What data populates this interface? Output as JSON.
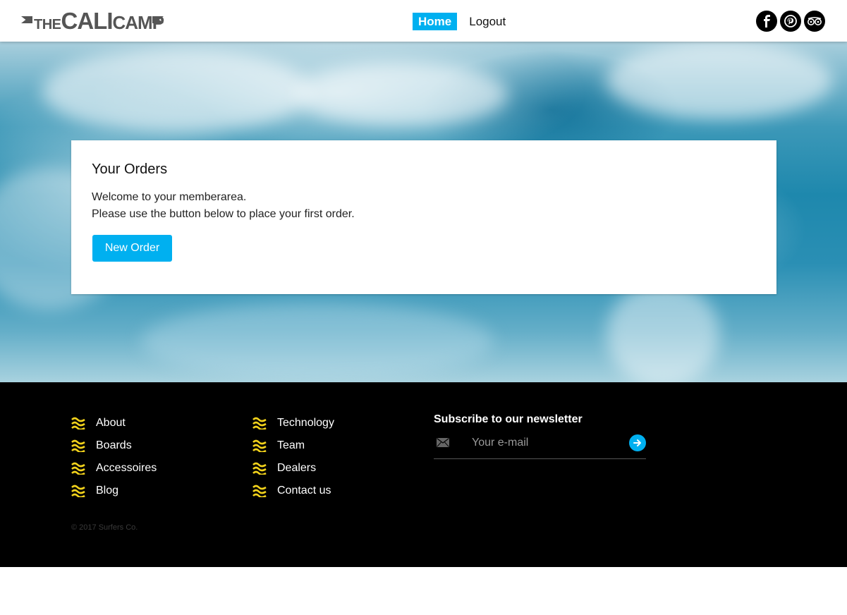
{
  "header": {
    "logo": {
      "the": "THE",
      "cali": "CALI",
      "camp": "CAMP"
    },
    "nav": [
      {
        "label": "Home",
        "active": true
      },
      {
        "label": "Logout",
        "active": false
      }
    ],
    "social_icons": [
      "facebook-icon",
      "pinterest-icon",
      "tripadvisor-icon"
    ]
  },
  "main": {
    "card": {
      "title": "Your Orders",
      "line1": "Welcome to your memberarea.",
      "line2": "Please use the button below to place your first order.",
      "button_label": "New Order"
    }
  },
  "footer": {
    "col1": [
      {
        "label": "About"
      },
      {
        "label": "Boards"
      },
      {
        "label": "Accessoires"
      },
      {
        "label": "Blog"
      }
    ],
    "col2": [
      {
        "label": "Technology"
      },
      {
        "label": "Team"
      },
      {
        "label": "Dealers"
      },
      {
        "label": "Contact us"
      }
    ],
    "newsletter": {
      "title": "Subscribe to our newsletter",
      "placeholder": "Your e-mail",
      "value": ""
    },
    "copyright": "© 2017 Surfers Co."
  },
  "colors": {
    "accent": "#00b0f0",
    "wave_icon": "#f2d21b",
    "footer_bg": "#000000"
  }
}
